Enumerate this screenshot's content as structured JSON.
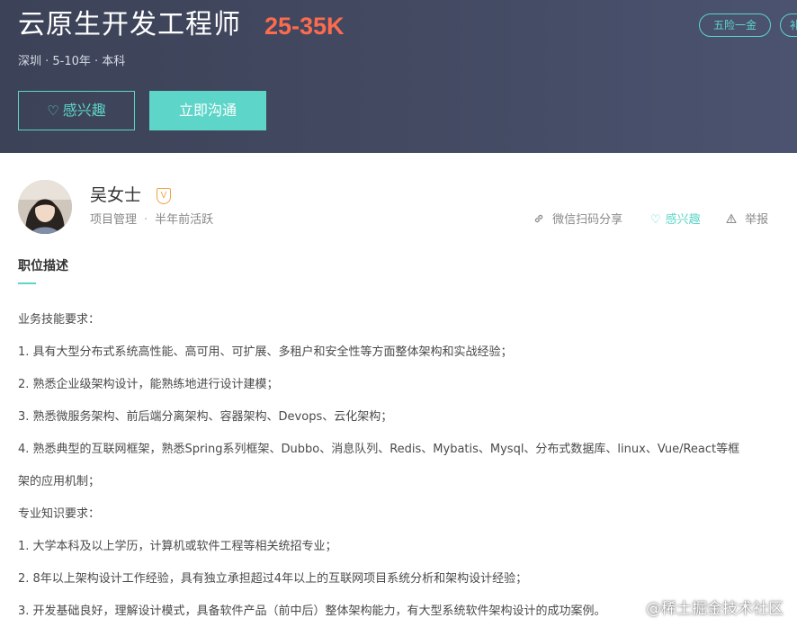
{
  "job": {
    "title": "云原生开发工程师",
    "salary": "25-35K",
    "meta": "深圳 · 5-10年 · 本科",
    "tags": [
      "五险一金",
      "补"
    ],
    "interest_label": "感兴趣",
    "chat_label": "立即沟通"
  },
  "recruiter": {
    "name": "吴女士",
    "badge": "V",
    "role": "项目管理",
    "separator": "·",
    "activity": "半年前活跃"
  },
  "actions": {
    "share": "微信扫码分享",
    "favorite": "感兴趣",
    "report": "举报"
  },
  "description": {
    "title": "职位描述",
    "lines": [
      "业务技能要求：",
      "1. 具有大型分布式系统高性能、高可用、可扩展、多租户和安全性等方面整体架构和实战经验；",
      "2. 熟悉企业级架构设计，能熟练地进行设计建模；",
      "3. 熟悉微服务架构、前后端分离架构、容器架构、Devops、云化架构；",
      "4. 熟悉典型的互联网框架，熟悉Spring系列框架、Dubbo、消息队列、Redis、Mybatis、Mysql、分布式数据库、linux、Vue/React等框",
      "架的应用机制；",
      "专业知识要求：",
      "1. 大学本科及以上学历，计算机或软件工程等相关统招专业；",
      "2. 8年以上架构设计工作经验，具有独立承担超过4年以上的互联网项目系统分析和架构设计经验；",
      "3. 开发基础良好，理解设计模式，具备软件产品（前中后）整体架构能力，有大型系统软件架构设计的成功案例。"
    ]
  },
  "watermark": "@稀土掘金技术社区",
  "colors": {
    "banner": "#3c4257",
    "accent": "#5dd5c8",
    "salary": "#fd6b4f",
    "badge": "#f0a247"
  }
}
